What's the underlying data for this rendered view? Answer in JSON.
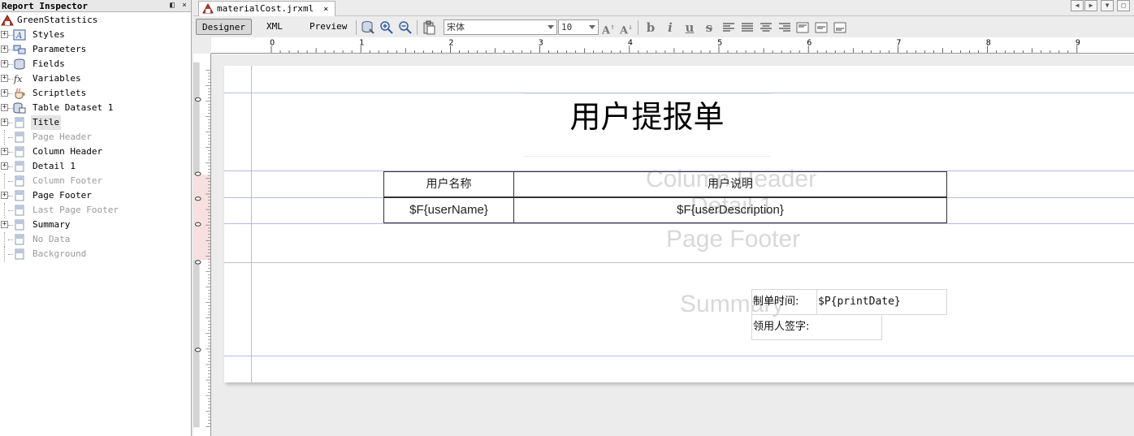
{
  "inspector": {
    "title": "Report Inspector",
    "pin_icon": "pin-icon",
    "close_icon": "close-icon",
    "root_label": "GreenStatistics",
    "items": [
      {
        "label": "Styles",
        "icon": "styles-icon",
        "expandable": true,
        "disabled": false
      },
      {
        "label": "Parameters",
        "icon": "parameters-icon",
        "expandable": true,
        "disabled": false
      },
      {
        "label": "Fields",
        "icon": "fields-icon",
        "expandable": true,
        "disabled": false
      },
      {
        "label": "Variables",
        "icon": "variables-icon",
        "expandable": true,
        "disabled": false
      },
      {
        "label": "Scriptlets",
        "icon": "scriptlets-icon",
        "expandable": true,
        "disabled": false
      },
      {
        "label": "Table Dataset 1",
        "icon": "dataset-icon",
        "expandable": true,
        "disabled": false
      },
      {
        "label": "Title",
        "icon": "band-icon",
        "expandable": true,
        "disabled": false,
        "selected": true
      },
      {
        "label": "Page Header",
        "icon": "band-icon",
        "expandable": false,
        "disabled": true
      },
      {
        "label": "Column Header",
        "icon": "band-icon",
        "expandable": true,
        "disabled": false
      },
      {
        "label": "Detail 1",
        "icon": "band-icon",
        "expandable": true,
        "disabled": false
      },
      {
        "label": "Column Footer",
        "icon": "band-icon",
        "expandable": false,
        "disabled": true
      },
      {
        "label": "Page Footer",
        "icon": "band-icon",
        "expandable": true,
        "disabled": false
      },
      {
        "label": "Last Page Footer",
        "icon": "band-icon",
        "expandable": false,
        "disabled": true
      },
      {
        "label": "Summary",
        "icon": "band-icon",
        "expandable": true,
        "disabled": false
      },
      {
        "label": "No Data",
        "icon": "band-icon",
        "expandable": false,
        "disabled": true
      },
      {
        "label": "Background",
        "icon": "band-icon",
        "expandable": false,
        "disabled": true
      }
    ]
  },
  "editor": {
    "tab_label": "materialCost.jrxml",
    "tab_close": "×",
    "modes": {
      "designer": "Designer",
      "xml": "XML",
      "preview": "Preview"
    },
    "font_name": "宋体",
    "font_size": "10",
    "ruler_labels": [
      "0",
      "1",
      "2",
      "3",
      "4",
      "5",
      "6",
      "7",
      "8",
      "9"
    ]
  },
  "report": {
    "title": "用户提报单",
    "band_watermarks": {
      "column_header": "Column Header",
      "detail": "Detail 1",
      "page_footer": "Page Footer",
      "summary": "Summary"
    },
    "columns": [
      {
        "header": "用户名称",
        "field": "$F{userName}"
      },
      {
        "header": "用户说明",
        "field": "$F{userDescription}"
      }
    ],
    "summary": {
      "print_date_label": "制单时间:",
      "print_date_value": "$P{printDate}",
      "signature_label": "领用人签字:"
    }
  }
}
